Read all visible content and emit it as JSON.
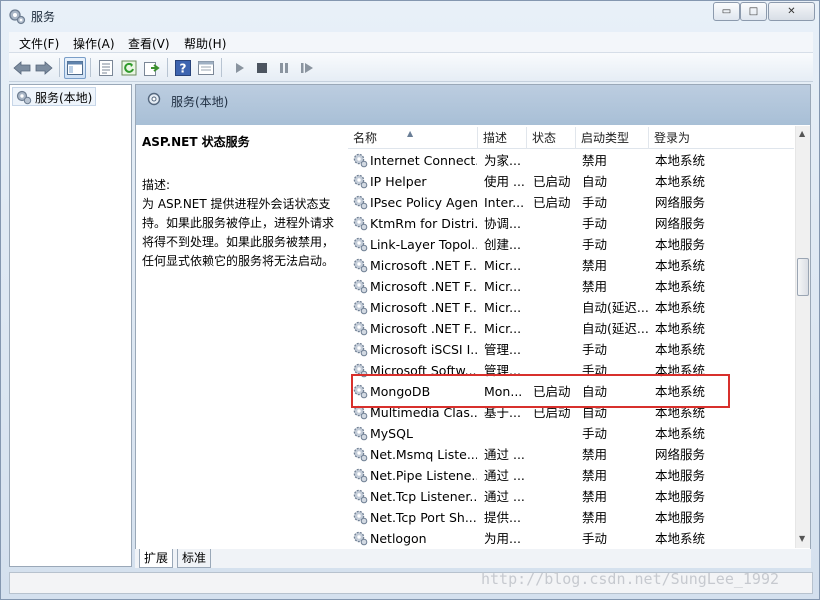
{
  "window": {
    "title": "服务",
    "controls": {
      "minimize": "▭",
      "maximize": "□",
      "close": "✕"
    }
  },
  "menu": [
    "文件(F)",
    "操作(A)",
    "查看(V)",
    "帮助(H)"
  ],
  "toolbar": [
    "back-icon",
    "forward-icon",
    "console-tree-icon",
    "properties-icon",
    "refresh-icon",
    "export-icon",
    "help-icon",
    "view-icon",
    "play-icon",
    "stop-icon",
    "pause-icon",
    "resume-icon"
  ],
  "tree": {
    "root": "服务(本地)"
  },
  "pane": {
    "header": "服务(本地)",
    "selected_title": "ASP.NET 状态服务",
    "desc_label": "描述:",
    "desc_text": "为 ASP.NET 提供进程外会话状态支持。如果此服务被停止，进程外请求将得不到处理。如果此服务被禁用，任何显式依赖它的服务将无法启动。"
  },
  "columns": [
    "名称",
    "描述",
    "状态",
    "启动类型",
    "登录为"
  ],
  "rows": [
    {
      "name": "Internet Connect...",
      "desc": "为家...",
      "status": "",
      "startup": "禁用",
      "logon": "本地系统"
    },
    {
      "name": "IP Helper",
      "desc": "使用 ...",
      "status": "已启动",
      "startup": "自动",
      "logon": "本地系统"
    },
    {
      "name": "IPsec Policy Agent",
      "desc": "Inter...",
      "status": "已启动",
      "startup": "手动",
      "logon": "网络服务"
    },
    {
      "name": "KtmRm for Distri...",
      "desc": "协调...",
      "status": "",
      "startup": "手动",
      "logon": "网络服务"
    },
    {
      "name": "Link-Layer Topol...",
      "desc": "创建...",
      "status": "",
      "startup": "手动",
      "logon": "本地服务"
    },
    {
      "name": "Microsoft .NET F...",
      "desc": "Micr...",
      "status": "",
      "startup": "禁用",
      "logon": "本地系统"
    },
    {
      "name": "Microsoft .NET F...",
      "desc": "Micr...",
      "status": "",
      "startup": "禁用",
      "logon": "本地系统"
    },
    {
      "name": "Microsoft .NET F...",
      "desc": "Micr...",
      "status": "",
      "startup": "自动(延迟...",
      "logon": "本地系统"
    },
    {
      "name": "Microsoft .NET F...",
      "desc": "Micr...",
      "status": "",
      "startup": "自动(延迟...",
      "logon": "本地系统"
    },
    {
      "name": "Microsoft iSCSI I...",
      "desc": "管理...",
      "status": "",
      "startup": "手动",
      "logon": "本地系统"
    },
    {
      "name": "Microsoft Softw...",
      "desc": "管理...",
      "status": "",
      "startup": "手动",
      "logon": "本地系统"
    },
    {
      "name": "MongoDB",
      "desc": "Mon...",
      "status": "已启动",
      "startup": "自动",
      "logon": "本地系统"
    },
    {
      "name": "Multimedia Clas...",
      "desc": "基于...",
      "status": "已启动",
      "startup": "自动",
      "logon": "本地系统"
    },
    {
      "name": "MySQL",
      "desc": "",
      "status": "",
      "startup": "手动",
      "logon": "本地系统"
    },
    {
      "name": "Net.Msmq Liste...",
      "desc": "通过 ...",
      "status": "",
      "startup": "禁用",
      "logon": "网络服务"
    },
    {
      "name": "Net.Pipe Listene...",
      "desc": "通过 ...",
      "status": "",
      "startup": "禁用",
      "logon": "本地服务"
    },
    {
      "name": "Net.Tcp Listener...",
      "desc": "通过 ...",
      "status": "",
      "startup": "禁用",
      "logon": "本地服务"
    },
    {
      "name": "Net.Tcp Port Sh...",
      "desc": "提供...",
      "status": "",
      "startup": "禁用",
      "logon": "本地服务"
    },
    {
      "name": "Netlogon",
      "desc": "为用...",
      "status": "",
      "startup": "手动",
      "logon": "本地系统"
    }
  ],
  "tabs": [
    "扩展",
    "标准"
  ],
  "watermark": "http://blog.csdn.net/SungLee_1992"
}
